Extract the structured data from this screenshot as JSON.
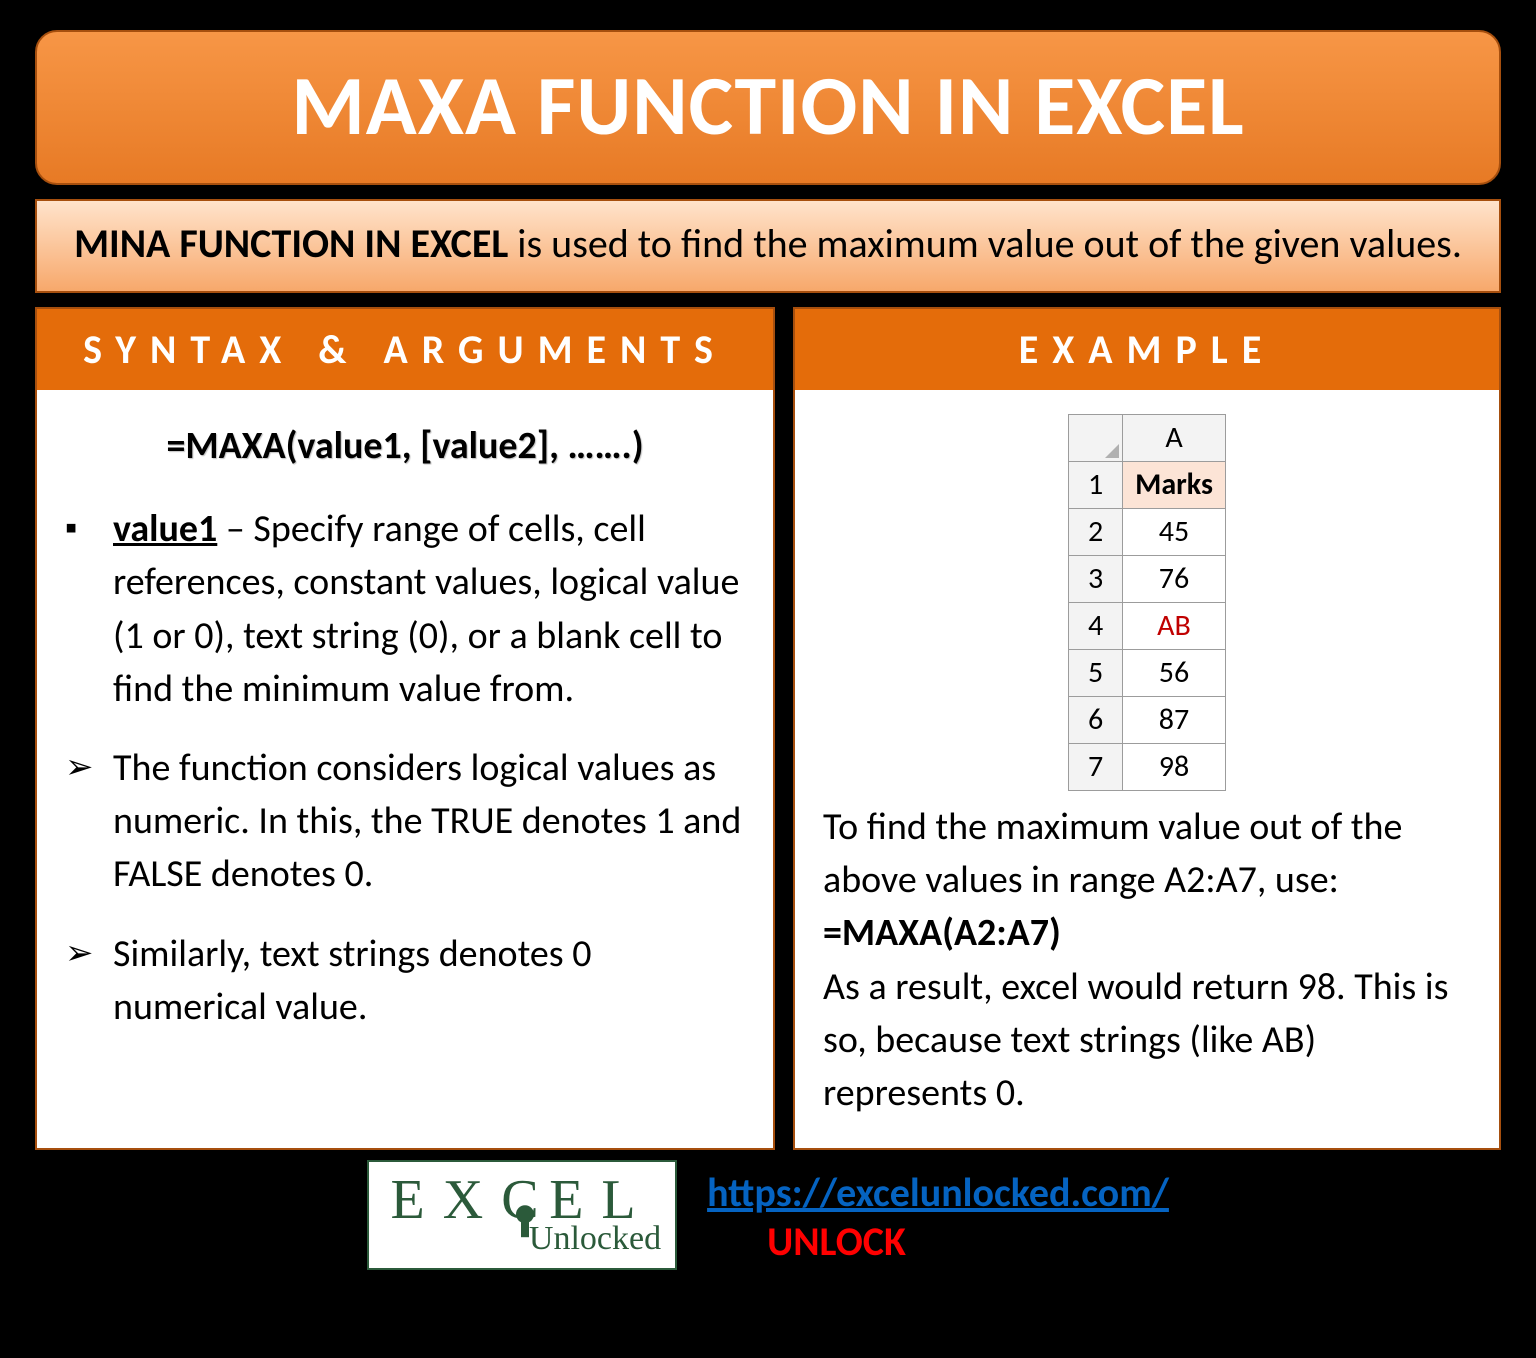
{
  "banner": {
    "title": "MAXA FUNCTION IN EXCEL"
  },
  "description": {
    "bold": "MINA FUNCTION IN EXCEL",
    "rest": " is used to find the maximum value out of the given values."
  },
  "left": {
    "header": "SYNTAX & ARGUMENTS",
    "syntax": "=MAXA(value1, [value2], …….)",
    "value1_label": "value1",
    "value1_text": " – Specify range of cells, cell references, constant values, logical value (1 or 0), text string (0), or a blank cell to find the minimum value from.",
    "note1": "The function considers logical values as numeric. In this, the TRUE denotes 1 and FALSE denotes 0.",
    "note2": "Similarly, text strings denotes 0 numerical value."
  },
  "right": {
    "header": "EXAMPLE",
    "table": {
      "colhead": "A",
      "rows": [
        {
          "n": "1",
          "v": "Marks",
          "cls": "marks-head"
        },
        {
          "n": "2",
          "v": "45",
          "cls": ""
        },
        {
          "n": "3",
          "v": "76",
          "cls": ""
        },
        {
          "n": "4",
          "v": "AB",
          "cls": "red"
        },
        {
          "n": "5",
          "v": "56",
          "cls": ""
        },
        {
          "n": "6",
          "v": "87",
          "cls": ""
        },
        {
          "n": "7",
          "v": "98",
          "cls": ""
        }
      ]
    },
    "p1": "To find the maximum value out of the above values in range A2:A7, use:",
    "formula": "=MAXA(A2:A7)",
    "p2": "As a result, excel would return 98. This is so, because text strings (like AB) represents 0."
  },
  "footer": {
    "logo_top_1": "EX",
    "logo_top_c": "C",
    "logo_top_2": "EL",
    "logo_bottom": "Unlocked",
    "url": "https://excelunlocked.com/",
    "unlock": "UNLOCK"
  }
}
